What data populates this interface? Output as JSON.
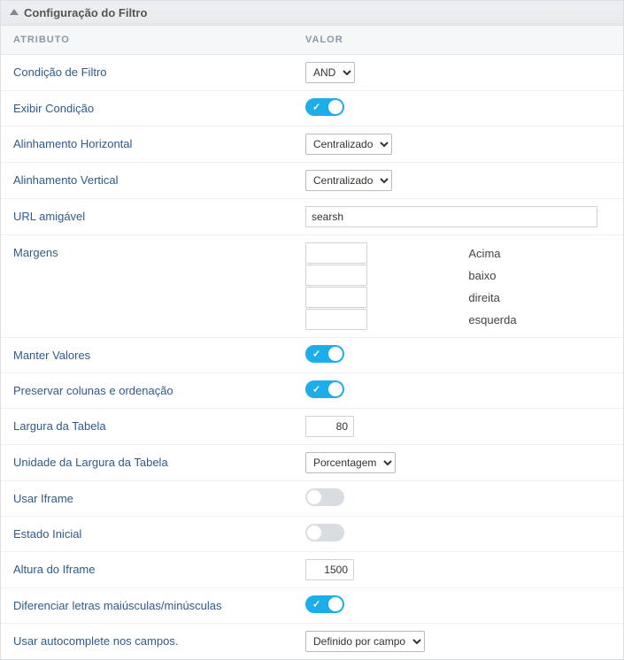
{
  "panel_title": "Configuração do Filtro",
  "columns": {
    "attr": "ATRIBUTO",
    "val": "VALOR"
  },
  "rows": {
    "filter_condition": {
      "label": "Condição de Filtro",
      "value": "AND"
    },
    "show_condition": {
      "label": "Exibir Condição",
      "on": true
    },
    "h_align": {
      "label": "Alinhamento Horizontal",
      "value": "Centralizado"
    },
    "v_align": {
      "label": "Alinhamento Vertical",
      "value": "Centralizado"
    },
    "friendly_url": {
      "label": "URL amigável",
      "value": "searsh"
    },
    "margins": {
      "label": "Margens",
      "top_label": "Acima",
      "top": "",
      "bottom_label": "baixo",
      "bottom": "",
      "right_label": "direita",
      "right": "",
      "left_label": "esquerda",
      "left": ""
    },
    "keep_values": {
      "label": "Manter Valores",
      "on": true
    },
    "preserve_cols": {
      "label": "Preservar colunas e ordenação",
      "on": true
    },
    "table_width": {
      "label": "Largura da Tabela",
      "value": "80"
    },
    "table_width_unit": {
      "label": "Unidade da Largura da Tabela",
      "value": "Porcentagem"
    },
    "use_iframe": {
      "label": "Usar Iframe",
      "on": false
    },
    "initial_state": {
      "label": "Estado Inicial",
      "on": false
    },
    "iframe_height": {
      "label": "Altura do Iframe",
      "value": "1500"
    },
    "case_sensitive": {
      "label": "Diferenciar letras maiúsculas/minúsculas",
      "on": true
    },
    "autocomplete": {
      "label": "Usar autocomplete nos campos.",
      "value": "Definido por campo"
    }
  }
}
